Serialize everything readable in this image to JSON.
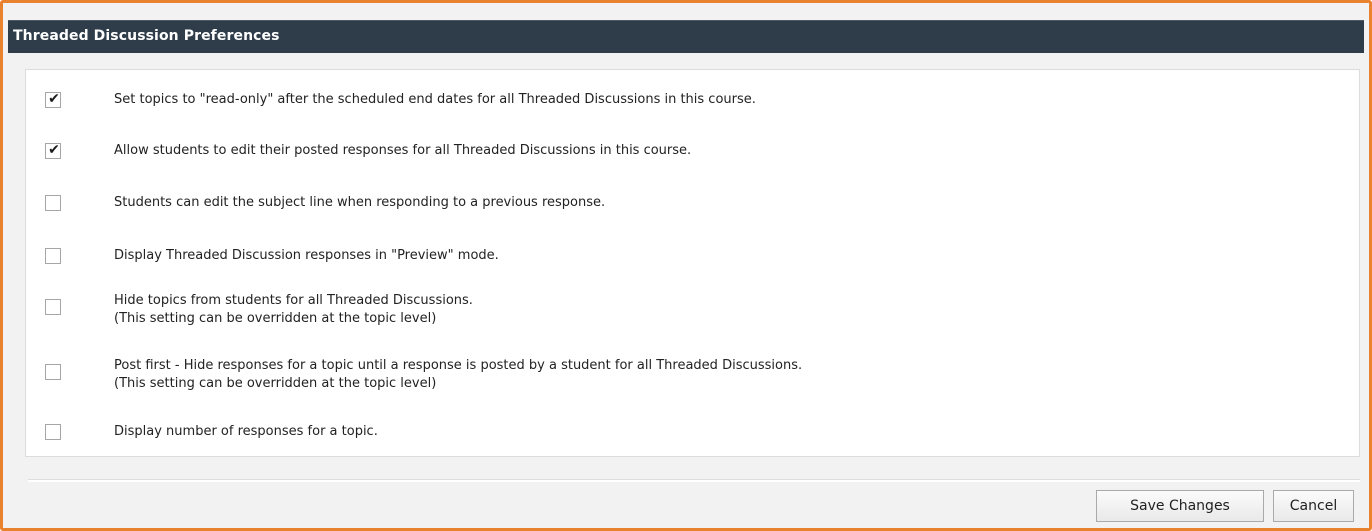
{
  "header": {
    "title": "Threaded Discussion Preferences"
  },
  "options": [
    {
      "checked": true,
      "line1": "Set topics to \"read-only\" after the scheduled end dates for all Threaded Discussions in this course.",
      "line2": ""
    },
    {
      "checked": true,
      "line1": "Allow students to edit their posted responses for all Threaded Discussions in this course.",
      "line2": ""
    },
    {
      "checked": false,
      "line1": "Students can edit the subject line when responding to a previous response.",
      "line2": ""
    },
    {
      "checked": false,
      "line1": "Display Threaded Discussion responses in \"Preview\" mode.",
      "line2": ""
    },
    {
      "checked": false,
      "line1": "Hide topics from students for all Threaded Discussions.",
      "line2": "(This setting can be overridden at the topic level)"
    },
    {
      "checked": false,
      "line1": "Post first - Hide responses for a topic until a response is posted by a student for all Threaded Discussions.",
      "line2": "(This setting can be overridden at the topic level)"
    },
    {
      "checked": false,
      "line1": "Display number of responses for a topic.",
      "line2": ""
    }
  ],
  "check_glyph": "✔",
  "footer": {
    "save_label": "Save Changes",
    "cancel_label": "Cancel"
  },
  "colors": {
    "accent_border": "#e9822f",
    "titlebar": "#2f3d4b"
  }
}
